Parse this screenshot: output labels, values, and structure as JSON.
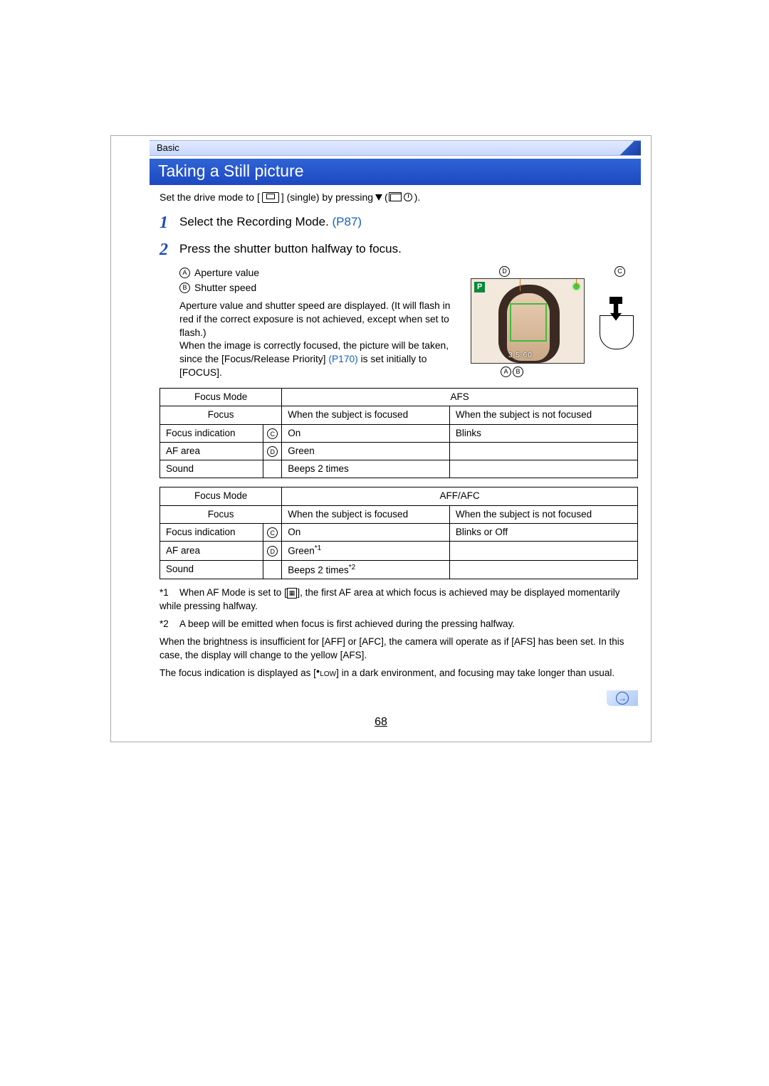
{
  "breadcrumb": "Basic",
  "title": "Taking a Still picture",
  "drive_mode_prefix": "Set the drive mode to [",
  "drive_mode_mid": "] (single) by pressing ",
  "drive_mode_suffix": ").",
  "step1": {
    "num": "1",
    "text": "Select the Recording Mode. ",
    "ref": "(P87)"
  },
  "step2": {
    "num": "2",
    "text": "Press the shutter button halfway to focus."
  },
  "labelA": "Aperture value",
  "labelB": "Shutter speed",
  "desc_part1": "Aperture value and shutter speed are displayed. (It will flash in red if the correct exposure is not achieved, except when set to flash.)",
  "desc_part2a": "When the image is correctly focused, the picture will be taken, since the [Focus/Release Priority] ",
  "desc_part2_ref": "(P170)",
  "desc_part2b": " is set initially to [FOCUS].",
  "figure": {
    "D": "D",
    "C": "C",
    "A": "A",
    "B": "B",
    "P": "P",
    "vals": "3.5 60"
  },
  "table1": {
    "focus_mode_label": "Focus Mode",
    "focus_mode_value": "AFS",
    "focus_label": "Focus",
    "col_focused": "When the subject is focused",
    "col_not_focused": "When the subject is not focused",
    "rows": [
      {
        "name": "Focus indication",
        "mark": "C",
        "focused": "On",
        "not_focused": "Blinks"
      },
      {
        "name": "AF area",
        "mark": "D",
        "focused": "Green",
        "not_focused": ""
      },
      {
        "name": "Sound",
        "mark": "",
        "focused": "Beeps 2 times",
        "not_focused": ""
      }
    ]
  },
  "table2": {
    "focus_mode_label": "Focus Mode",
    "focus_mode_value": "AFF/AFC",
    "focus_label": "Focus",
    "col_focused": "When the subject is focused",
    "col_not_focused": "When the subject is not focused",
    "rows": [
      {
        "name": "Focus indication",
        "mark": "C",
        "focused": "On",
        "not_focused": "Blinks or Off"
      },
      {
        "name": "AF area",
        "mark": "D",
        "focused": "Green",
        "focused_sup": "*1",
        "not_focused": ""
      },
      {
        "name": "Sound",
        "mark": "",
        "focused": "Beeps 2 times",
        "focused_sup": "*2",
        "not_focused": ""
      }
    ]
  },
  "note1_ref": "*1",
  "note1a": "When AF Mode is set to [",
  "note1b": "], the first AF area at which focus is achieved may be displayed momentarily while pressing halfway.",
  "note2_ref": "*2",
  "note2": "A beep will be emitted when focus is first achieved during the pressing halfway.",
  "note3": "When the brightness is insufficient for [AFF] or [AFC], the camera will operate as if [AFS] has been set. In this case, the display will change to the yellow [AFS].",
  "note4a": "The focus indication is displayed as [",
  "note4_low": "LOW",
  "note4b": "] in a dark environment, and focusing may take longer than usual.",
  "page_number": "68"
}
